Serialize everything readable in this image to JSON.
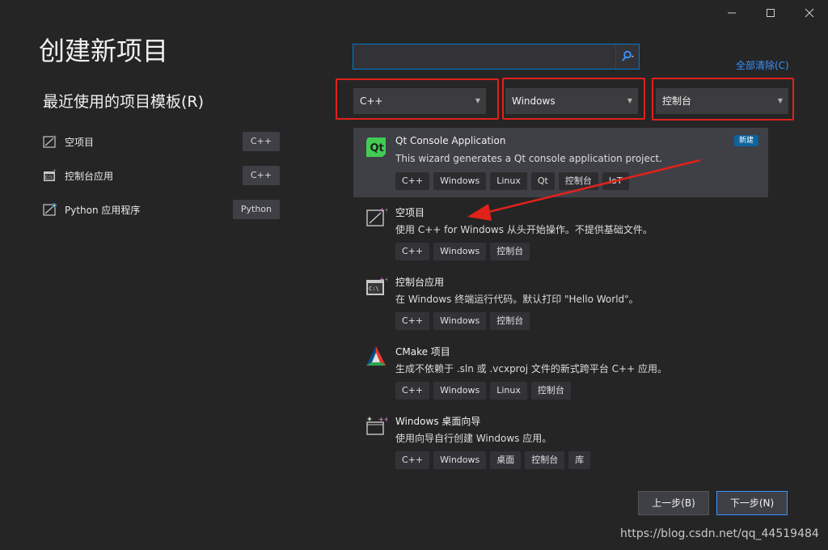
{
  "window": {
    "minimize_icon": "minimize-icon",
    "maximize_icon": "maximize-icon",
    "close_icon": "close-icon"
  },
  "page": {
    "title": "创建新项目",
    "recent_title": "最近使用的项目模板(R)"
  },
  "recent_templates": [
    {
      "label": "空项目",
      "tag": "C++",
      "icon": "empty-project-icon"
    },
    {
      "label": "控制台应用",
      "tag": "C++",
      "icon": "console-app-icon"
    },
    {
      "label": "Python 应用程序",
      "tag": "Python",
      "icon": "python-app-icon"
    }
  ],
  "search": {
    "value": "",
    "placeholder": "",
    "icon": "search-icon"
  },
  "clear_all": "全部清除(C)",
  "filters": {
    "language": "C++",
    "platform": "Windows",
    "project_type": "控制台"
  },
  "templates": [
    {
      "name": "Qt Console Application",
      "description": "This wizard generates a Qt console application project.",
      "tags": [
        "C++",
        "Windows",
        "Linux",
        "Qt",
        "控制台",
        "IoT"
      ],
      "badge": "新建",
      "icon": "qt-icon",
      "selected": true
    },
    {
      "name": "空项目",
      "description": "使用 C++ for Windows 从头开始操作。不提供基础文件。",
      "tags": [
        "C++",
        "Windows",
        "控制台"
      ],
      "icon": "empty-project-icon"
    },
    {
      "name": "控制台应用",
      "description": "在 Windows 终端运行代码。默认打印 \"Hello World\"。",
      "tags": [
        "C++",
        "Windows",
        "控制台"
      ],
      "icon": "console-app-icon"
    },
    {
      "name": "CMake 项目",
      "description": "生成不依赖于 .sln 或 .vcxproj 文件的新式跨平台 C++ 应用。",
      "tags": [
        "C++",
        "Windows",
        "Linux",
        "控制台"
      ],
      "icon": "cmake-icon"
    },
    {
      "name": "Windows 桌面向导",
      "description": "使用向导自行创建 Windows 应用。",
      "tags": [
        "C++",
        "Windows",
        "桌面",
        "控制台",
        "库"
      ],
      "icon": "desktop-wizard-icon"
    }
  ],
  "buttons": {
    "back": "上一步(B)",
    "next": "下一步(N)"
  },
  "watermark": "https://blog.csdn.net/qq_44519484",
  "colors": {
    "background": "#252526",
    "accent": "#007acc",
    "highlight": "#e0221b",
    "link": "#3794ff",
    "qt_green": "#41cd52"
  }
}
